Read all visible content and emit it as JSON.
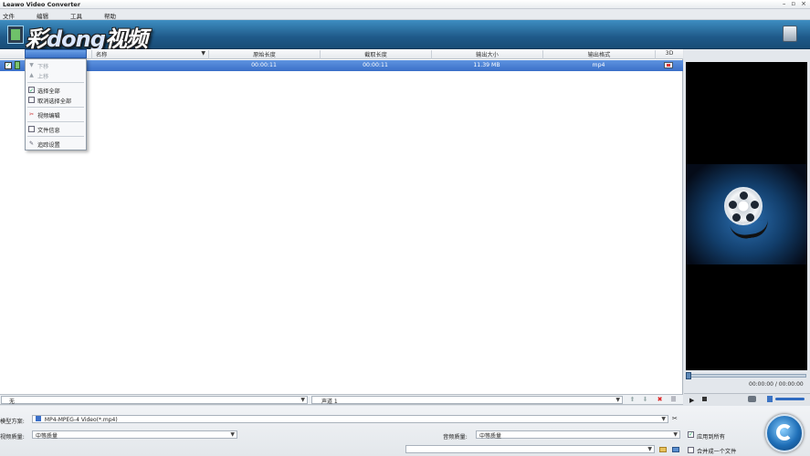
{
  "window": {
    "title": "Leawo Video Converter",
    "controls": [
      "–",
      "▫",
      "×"
    ]
  },
  "menu": [
    "文件",
    "编辑",
    "工具",
    "帮助"
  ],
  "toolbar": {
    "brand_text": "彩dong视频"
  },
  "columns": [
    "名称",
    "原始长度",
    "截取长度",
    "输出大小",
    "输出格式",
    "3D"
  ],
  "file_row": {
    "checked": true,
    "original_length": "00:00:11",
    "clip_length": "00:00:11",
    "output_size": "11.39 MB",
    "output_format": "mp4"
  },
  "context_menu": {
    "items": [
      {
        "label": "下移",
        "enabled": false,
        "icon": "arrow-down-icon"
      },
      {
        "label": "上移",
        "enabled": false,
        "icon": "arrow-up-icon"
      },
      {
        "label": "选择全部",
        "enabled": true,
        "icon": "check-icon"
      },
      {
        "label": "取消选择全部",
        "enabled": true,
        "icon": "uncheck-icon"
      },
      {
        "label": "视频编辑",
        "enabled": true,
        "icon": "scissors-icon"
      },
      {
        "label": "文件信息",
        "enabled": true,
        "icon": "file-info-icon"
      },
      {
        "label": "追踪设置",
        "enabled": true,
        "icon": "wrench-icon"
      }
    ]
  },
  "preview": {
    "time": "00:00:00 / 00:00:00",
    "volume_level": 1.0
  },
  "tracks": {
    "subtitle": "无",
    "audio": "声道 1"
  },
  "settings": {
    "profile_label": "模型方案:",
    "profile_value": "MP4-MPEG-4 Video(*.mp4)",
    "video_quality_label": "视频质量:",
    "video_quality_value": "中等质量",
    "audio_quality_label": "音频质量:",
    "audio_quality_value": "中等质量",
    "apply_to_all_label": "应用到所有",
    "apply_to_all_checked": true,
    "merge_label": "合并成一个文件",
    "merge_checked": false
  }
}
